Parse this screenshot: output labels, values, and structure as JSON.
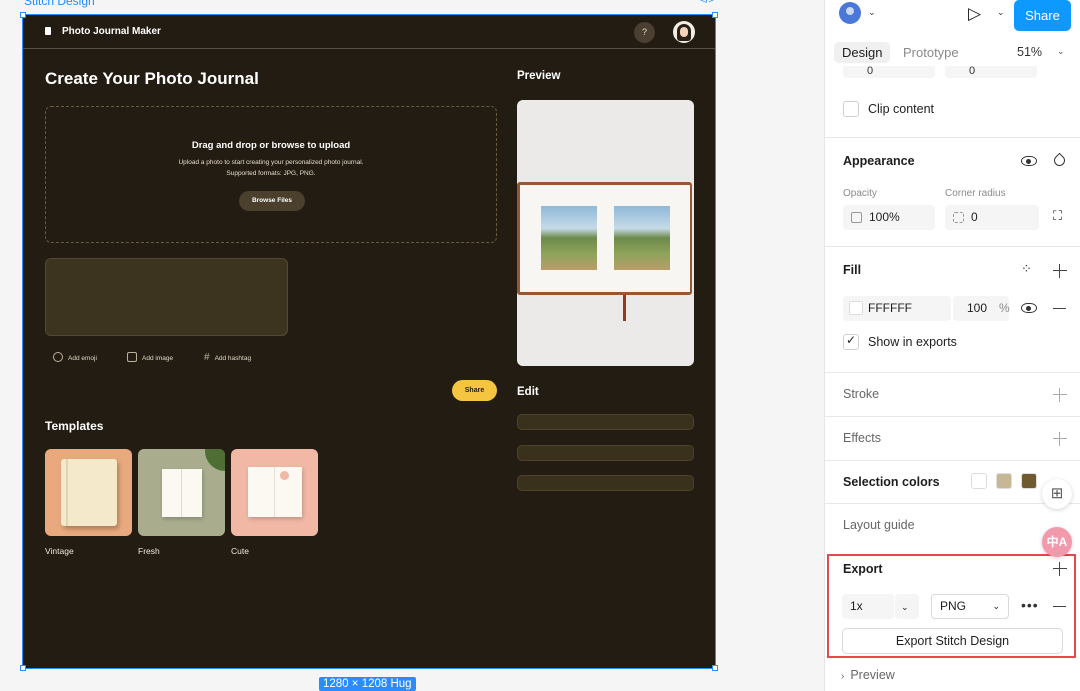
{
  "canvas": {
    "frame_label": "Stitch Design",
    "code_icon": "code-icon",
    "size_badge": "1280 × 1208 Hug"
  },
  "design": {
    "app_name": "Photo Journal Maker",
    "help_glyph": "?",
    "page_title": "Create Your Photo Journal",
    "upload": {
      "title": "Drag and drop or browse to upload",
      "subtitle_line1": "Upload a photo to start creating your personalized photo journal.",
      "subtitle_line2": "Supported formats: JPG, PNG.",
      "button": "Browse Files"
    },
    "tools": {
      "emoji": "Add emoji",
      "image": "Add image",
      "hashtag": "Add hashtag"
    },
    "share_button": "Share",
    "templates_heading": "Templates",
    "templates": [
      {
        "label": "Vintage",
        "bg": "#e9a97e"
      },
      {
        "label": "Fresh",
        "bg": "#a9ad8e"
      },
      {
        "label": "Cute",
        "bg": "#f2b8a6"
      }
    ],
    "preview_heading": "Preview",
    "edit_heading": "Edit"
  },
  "panel": {
    "share_button": "Share",
    "tabs": {
      "design": "Design",
      "prototype": "Prototype"
    },
    "zoom": "51%",
    "cut_values": {
      "left": "0",
      "right": "0"
    },
    "clip_content": "Clip content",
    "appearance": {
      "heading": "Appearance",
      "opacity_label": "Opacity",
      "opacity_value": "100%",
      "radius_label": "Corner radius",
      "radius_value": "0"
    },
    "fill": {
      "heading": "Fill",
      "hex": "FFFFFF",
      "opacity": "100",
      "percent": "%",
      "show_in_exports": "Show in exports"
    },
    "stroke": "Stroke",
    "effects": "Effects",
    "selection_colors": {
      "heading": "Selection colors",
      "colors": [
        "#ffffff",
        "#c7b795",
        "#6e5a2e"
      ]
    },
    "layout_guide": "Layout guide",
    "export": {
      "heading": "Export",
      "scale": "1x",
      "format": "PNG",
      "button": "Export Stitch Design"
    },
    "preview": "Preview",
    "translate_badge": "中A"
  }
}
